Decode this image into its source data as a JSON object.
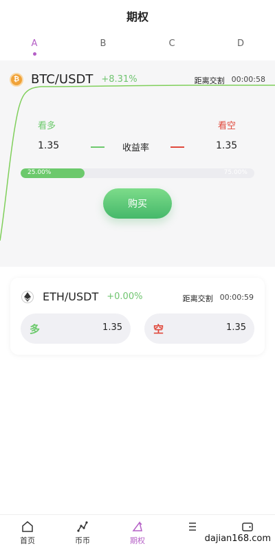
{
  "header": {
    "title": "期权"
  },
  "tabs": [
    {
      "label": "A",
      "active": true
    },
    {
      "label": "B",
      "active": false
    },
    {
      "label": "C",
      "active": false
    },
    {
      "label": "D",
      "active": false
    }
  ],
  "btc": {
    "pair": "BTC/USDT",
    "change": "+8.31%",
    "settle_label": "距离交割",
    "countdown": "00:00:58",
    "call_label": "看多",
    "put_label": "看空",
    "call_odds": "1.35",
    "rate_label": "收益率",
    "put_odds": "1.35",
    "progress_left": "25.00%",
    "progress_right": "75.00%",
    "progress_fraction": 0.25,
    "buy_label": "购买"
  },
  "eth": {
    "pair": "ETH/USDT",
    "change": "+0.00%",
    "settle_label": "距离交割",
    "countdown": "00:00:59",
    "long_label": "多",
    "long_value": "1.35",
    "short_label": "空",
    "short_value": "1.35"
  },
  "nav": [
    {
      "label": "首页",
      "icon": "home-icon",
      "active": false
    },
    {
      "label": "币币",
      "icon": "chart-icon",
      "active": false
    },
    {
      "label": "期权",
      "icon": "options-icon",
      "active": true
    },
    {
      "label": "",
      "icon": "list-icon",
      "active": false
    },
    {
      "label": "",
      "icon": "wallet-icon",
      "active": false
    }
  ],
  "watermark": "dajian168.com",
  "colors": {
    "accent": "#b45ec6",
    "up": "#6cc96c",
    "down": "#e0483b"
  }
}
